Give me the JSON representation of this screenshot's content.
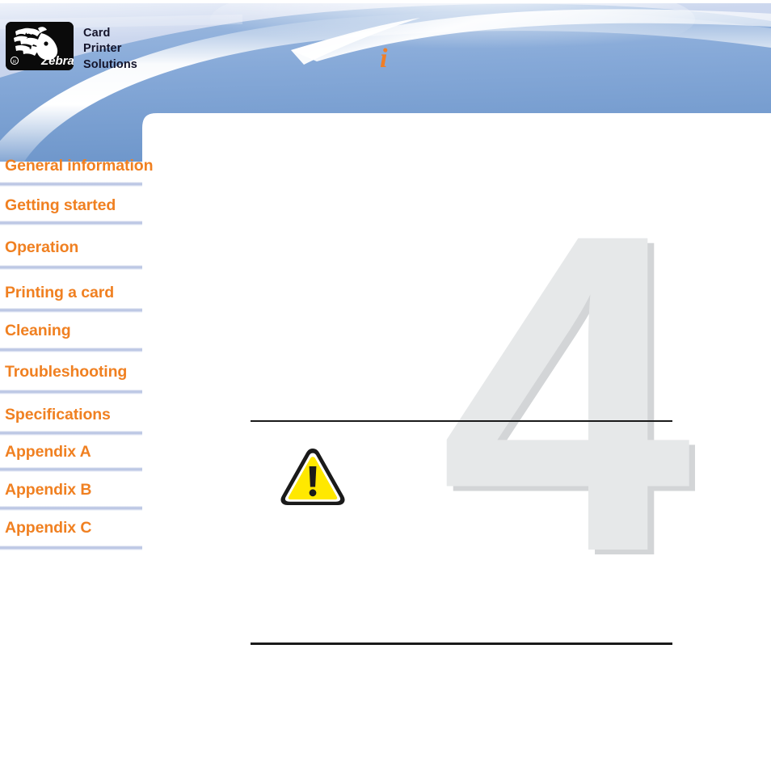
{
  "document": {
    "title": "Zebra Card Printer Solutions",
    "chapter_number": "4"
  },
  "header": {
    "logo": {
      "icon": "zebra-head-logo",
      "wordmark": "Zebra",
      "registered_mark": "®"
    },
    "brand_text": "Card\nPrinter\nSolutions",
    "info_mark": "i",
    "colors": {
      "banner_blue": "#7ca2d4",
      "banner_light": "#ccd8ee",
      "swoosh_white": "#ffffff"
    }
  },
  "sidebar": {
    "items": [
      {
        "label": "General information"
      },
      {
        "label": "Getting started"
      },
      {
        "label": "Operation"
      },
      {
        "label": "Printing a card"
      },
      {
        "label": "Cleaning"
      },
      {
        "label": "Troubleshooting"
      },
      {
        "label": "Specifications"
      },
      {
        "label": "Appendix A"
      },
      {
        "label": "Appendix B"
      },
      {
        "label": "Appendix C"
      }
    ],
    "colors": {
      "link_orange": "#F08021",
      "divider_blue": "#b7c3e2"
    }
  },
  "main": {
    "watermark_number": "4",
    "warning_icon": "warning-triangle-exclamation",
    "colors": {
      "watermark_fill": "#e6e8e9",
      "watermark_shadow": "#d3d5d7",
      "warning_yellow": "#FFE800",
      "warning_outline": "#1a1a1a",
      "rule": "#1a1a1a"
    }
  }
}
